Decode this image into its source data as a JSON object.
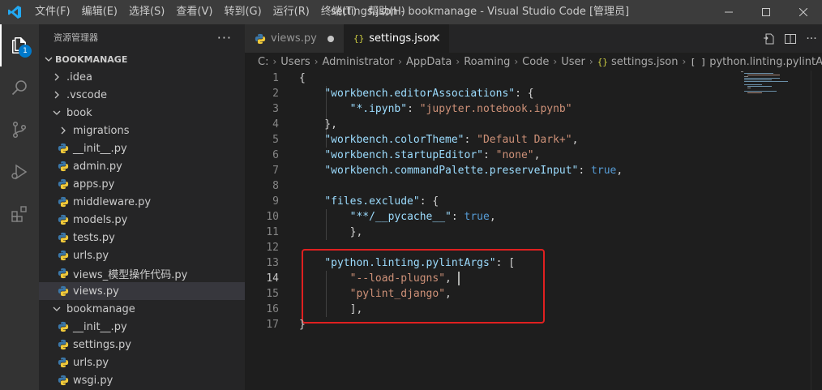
{
  "titlebar": {
    "menu": [
      "文件(F)",
      "编辑(E)",
      "选择(S)",
      "查看(V)",
      "转到(G)",
      "运行(R)",
      "终端(T)",
      "帮助(H)"
    ],
    "window_title": "settings.json - bookmanage - Visual Studio Code [管理员]"
  },
  "activitybar": {
    "items": [
      "explorer-icon",
      "search-icon",
      "source-control-icon",
      "run-debug-icon",
      "extensions-icon"
    ],
    "explorer_badge": "1"
  },
  "sidebar": {
    "title": "资源管理器",
    "section": "BOOKMANAGE",
    "items": [
      {
        "label": ".idea",
        "type": "folder",
        "expanded": false,
        "depth": 0
      },
      {
        "label": ".vscode",
        "type": "folder",
        "expanded": false,
        "depth": 0
      },
      {
        "label": "book",
        "type": "folder",
        "expanded": true,
        "depth": 0
      },
      {
        "label": "migrations",
        "type": "folder",
        "expanded": false,
        "depth": 1
      },
      {
        "label": "__init__.py",
        "type": "py",
        "depth": 1
      },
      {
        "label": "admin.py",
        "type": "py",
        "depth": 1
      },
      {
        "label": "apps.py",
        "type": "py",
        "depth": 1
      },
      {
        "label": "middleware.py",
        "type": "py",
        "depth": 1
      },
      {
        "label": "models.py",
        "type": "py",
        "depth": 1
      },
      {
        "label": "tests.py",
        "type": "py",
        "depth": 1
      },
      {
        "label": "urls.py",
        "type": "py",
        "depth": 1
      },
      {
        "label": "views_模型操作代码.py",
        "type": "py",
        "depth": 1
      },
      {
        "label": "views.py",
        "type": "py",
        "depth": 1,
        "selected": true
      },
      {
        "label": "bookmanage",
        "type": "folder",
        "expanded": true,
        "depth": 0
      },
      {
        "label": "__init__.py",
        "type": "py",
        "depth": 1
      },
      {
        "label": "settings.py",
        "type": "py",
        "depth": 1
      },
      {
        "label": "urls.py",
        "type": "py",
        "depth": 1
      },
      {
        "label": "wsgi.py",
        "type": "py",
        "depth": 1
      }
    ]
  },
  "tabs": [
    {
      "label": "views.py",
      "modified": true,
      "active": false
    },
    {
      "label": "settings.json",
      "modified": false,
      "active": true
    }
  ],
  "breadcrumb": [
    "C:",
    "Users",
    "Administrator",
    "AppData",
    "Roaming",
    "Code",
    "User",
    "settings.json",
    "python.linting.pylintArgs"
  ],
  "editor": {
    "current_line": 14,
    "lines": [
      {
        "n": "1",
        "t": [
          [
            "p",
            "{"
          ]
        ]
      },
      {
        "n": "2",
        "t": [
          [
            "p",
            "    "
          ],
          [
            "k",
            "\"workbench.editorAssociations\""
          ],
          [
            "p",
            ": {"
          ]
        ]
      },
      {
        "n": "3",
        "t": [
          [
            "p",
            "        "
          ],
          [
            "k",
            "\"*.ipynb\""
          ],
          [
            "p",
            ": "
          ],
          [
            "s",
            "\"jupyter.notebook.ipynb\""
          ]
        ]
      },
      {
        "n": "4",
        "t": [
          [
            "p",
            "    },"
          ]
        ]
      },
      {
        "n": "5",
        "t": [
          [
            "p",
            "    "
          ],
          [
            "k",
            "\"workbench.colorTheme\""
          ],
          [
            "p",
            ": "
          ],
          [
            "s",
            "\"Default Dark+\""
          ],
          [
            "p",
            ","
          ]
        ]
      },
      {
        "n": "6",
        "t": [
          [
            "p",
            "    "
          ],
          [
            "k",
            "\"workbench.startupEditor\""
          ],
          [
            "p",
            ": "
          ],
          [
            "s",
            "\"none\""
          ],
          [
            "p",
            ","
          ]
        ]
      },
      {
        "n": "7",
        "t": [
          [
            "p",
            "    "
          ],
          [
            "k",
            "\"workbench.commandPalette.preserveInput\""
          ],
          [
            "p",
            ": "
          ],
          [
            "b",
            "true"
          ],
          [
            "p",
            ","
          ]
        ]
      },
      {
        "n": "8",
        "t": []
      },
      {
        "n": "9",
        "t": [
          [
            "p",
            "    "
          ],
          [
            "k",
            "\"files.exclude\""
          ],
          [
            "p",
            ": {"
          ]
        ]
      },
      {
        "n": "10",
        "t": [
          [
            "p",
            "        "
          ],
          [
            "k",
            "\"**/__pycache__\""
          ],
          [
            "p",
            ": "
          ],
          [
            "b",
            "true"
          ],
          [
            "p",
            ","
          ]
        ]
      },
      {
        "n": "11",
        "t": [
          [
            "p",
            "        },"
          ]
        ]
      },
      {
        "n": "12",
        "t": []
      },
      {
        "n": "13",
        "t": [
          [
            "p",
            "    "
          ],
          [
            "k",
            "\"python.linting.pylintArgs\""
          ],
          [
            "p",
            ": ["
          ]
        ]
      },
      {
        "n": "14",
        "t": [
          [
            "p",
            "        "
          ],
          [
            "s",
            "\"--load-plugns\""
          ],
          [
            "p",
            ","
          ]
        ]
      },
      {
        "n": "15",
        "t": [
          [
            "p",
            "        "
          ],
          [
            "s",
            "\"pylint_django\""
          ],
          [
            "p",
            ","
          ]
        ]
      },
      {
        "n": "16",
        "t": [
          [
            "p",
            "        ],"
          ]
        ]
      },
      {
        "n": "17",
        "t": [
          [
            "p",
            "}"
          ]
        ]
      }
    ]
  }
}
